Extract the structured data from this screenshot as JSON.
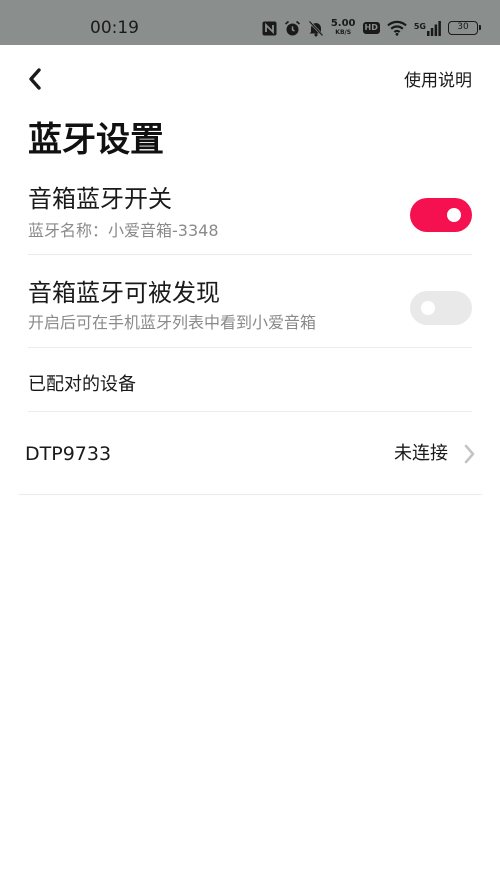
{
  "status_bar": {
    "time": "00:19",
    "net_speed_value": "5.00",
    "net_speed_unit": "KB/S",
    "hd_label": "HD",
    "network_label": "5G",
    "battery": "30",
    "icons": [
      "nfc-icon",
      "alarm-icon",
      "mute-icon",
      "hd-icon",
      "wifi-icon",
      "signal-icon",
      "battery-icon"
    ]
  },
  "header": {
    "back_icon": "chevron-left-icon",
    "help_label": "使用说明"
  },
  "page": {
    "title": "蓝牙设置"
  },
  "settings": {
    "bluetooth_switch": {
      "title": "音箱蓝牙开关",
      "subtitle": "蓝牙名称：小爱音箱-3348",
      "enabled": true
    },
    "discoverable": {
      "title": "音箱蓝牙可被发现",
      "subtitle": "开启后可在手机蓝牙列表中看到小爱音箱",
      "enabled": false
    }
  },
  "paired_devices": {
    "section_title": "已配对的设备",
    "items": [
      {
        "name": "DTP9733",
        "status": "未连接",
        "icon": "chevron-right-icon"
      }
    ]
  },
  "colors": {
    "accent": "#f5104f",
    "status_bar_bg": "#8a8f8d",
    "toggle_off": "#e9e9e9",
    "secondary_text": "#8a8a8a"
  }
}
